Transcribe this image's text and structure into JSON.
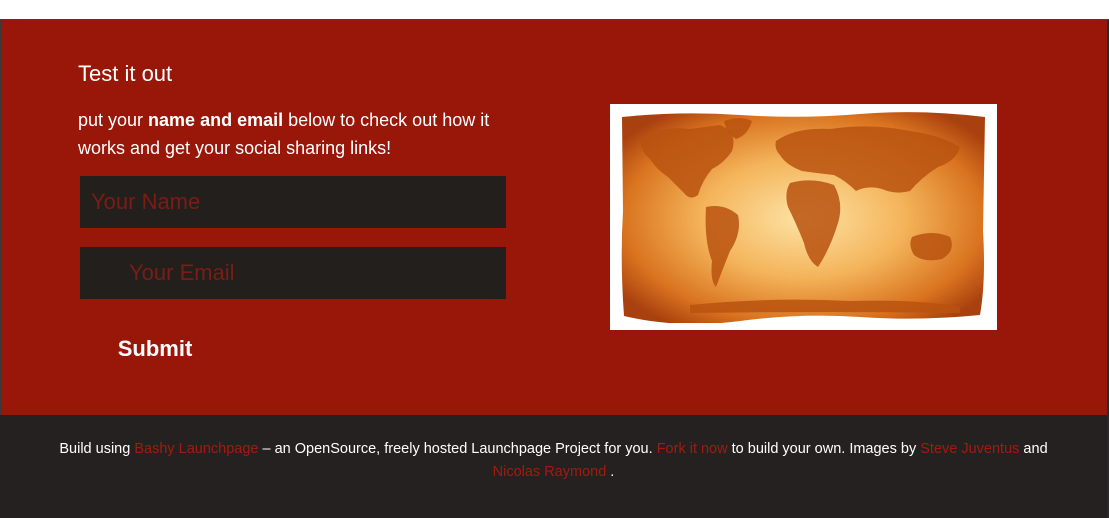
{
  "hero": {
    "heading": "Test it out",
    "intro_before": "put your ",
    "intro_bold": "name and email",
    "intro_after": " below to check out how it works and get your social sharing links!",
    "name_placeholder": "Your Name",
    "email_placeholder": "Your Email",
    "submit_label": "Submit",
    "image_icon": "world-map-image"
  },
  "footer": {
    "text_1": "Build using ",
    "link_1": "Bashy Launchpage",
    "text_2": " – an OpenSource, freely hosted Launchpage Project for you. ",
    "link_2": "Fork it now",
    "text_3": " to build your own. Images by ",
    "link_3": "Steve Juventus",
    "text_4": " and ",
    "link_4": "Nicolas Raymond",
    "text_5": " ."
  },
  "colors": {
    "hero_bg": "#991708",
    "footer_bg": "#252120",
    "input_bg": "#221f1d",
    "link": "#a21b10"
  }
}
